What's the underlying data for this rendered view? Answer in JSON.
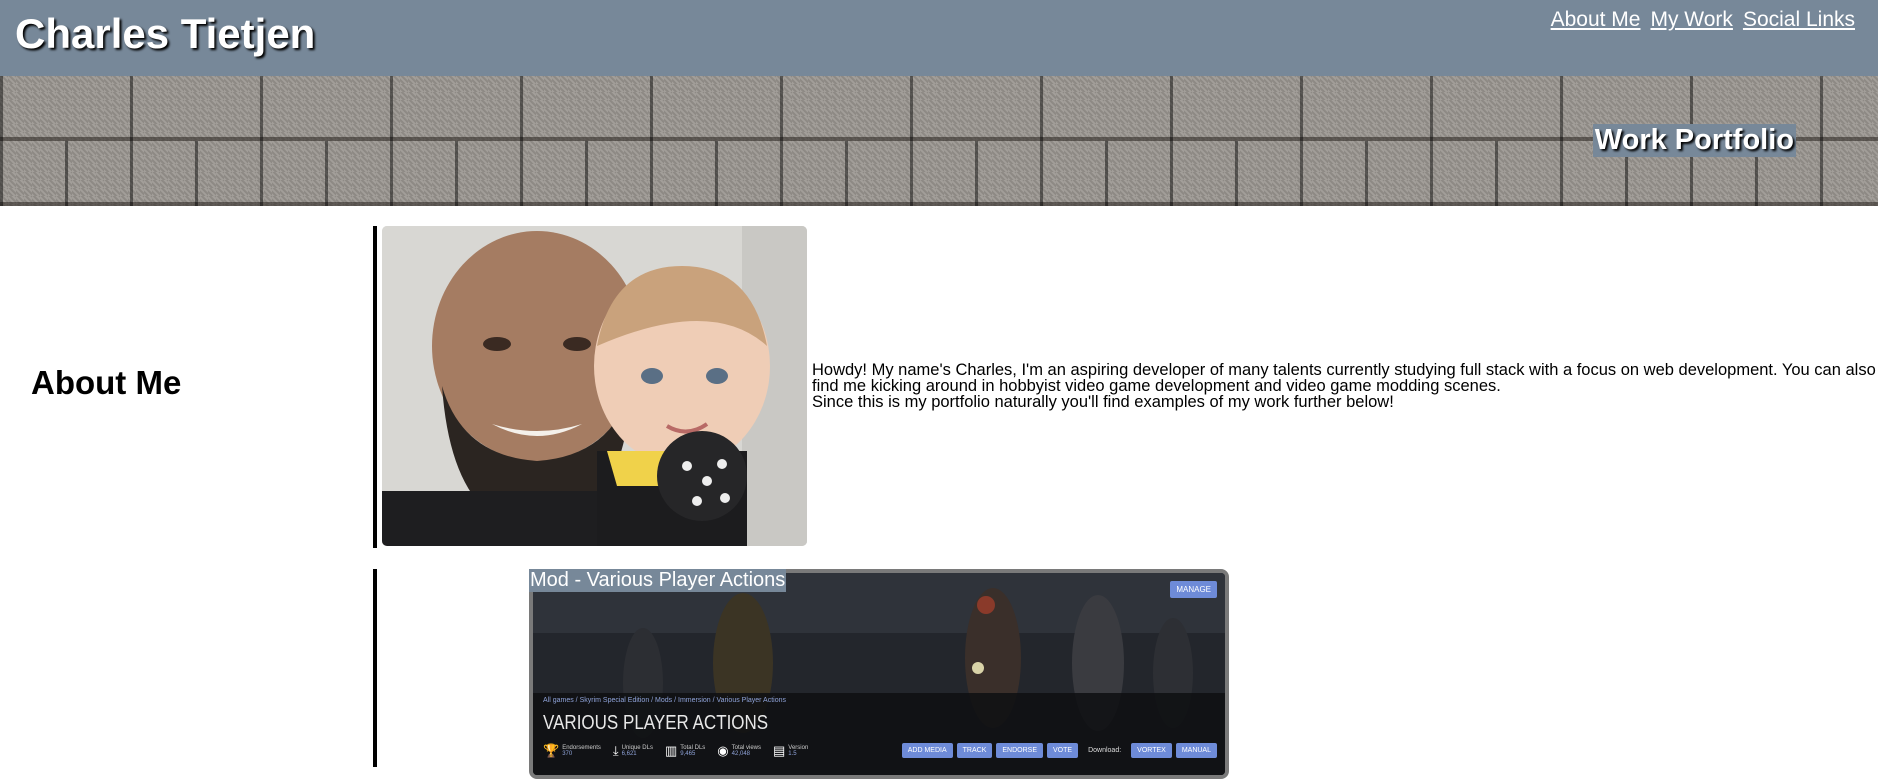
{
  "header": {
    "title": "Charles Tietjen",
    "nav": [
      "About Me",
      "My Work",
      "Social Links"
    ]
  },
  "banner": {
    "title": "Work Portfolio"
  },
  "about": {
    "heading": "About Me",
    "paragraph1": "Howdy! My name's Charles, I'm an aspiring developer of many talents currently studying full stack with a focus on web development. You can also find me kicking around in hobbyist video game development and video game modding scenes.",
    "paragraph2": "Since this is my portfolio naturally you'll find examples of my work further below!"
  },
  "work": {
    "title": "Mod - Various Player Actions",
    "screenshot": {
      "manage": "MANAGE",
      "breadcrumb": "All games / Skyrim Special Edition / Mods / Immersion / Various Player Actions",
      "mod_name": "VARIOUS PLAYER ACTIONS",
      "stats": [
        {
          "label": "Endorsements",
          "value": "370",
          "icon": "trophy-icon"
        },
        {
          "label": "Unique DLs",
          "value": "6,621",
          "icon": "download-icon"
        },
        {
          "label": "Total DLs",
          "value": "9,465",
          "icon": "chart-icon"
        },
        {
          "label": "Total views",
          "value": "42,048",
          "icon": "eye-icon"
        },
        {
          "label": "Version",
          "value": "1.5",
          "icon": "file-icon"
        }
      ],
      "actions": [
        "ADD MEDIA",
        "TRACK",
        "ENDORSE",
        "VOTE"
      ],
      "download_label": "Download:",
      "downloads": [
        "VORTEX",
        "MANUAL"
      ]
    }
  },
  "colors": {
    "header_bg": "#778899",
    "accent": "#6e8bd8"
  }
}
